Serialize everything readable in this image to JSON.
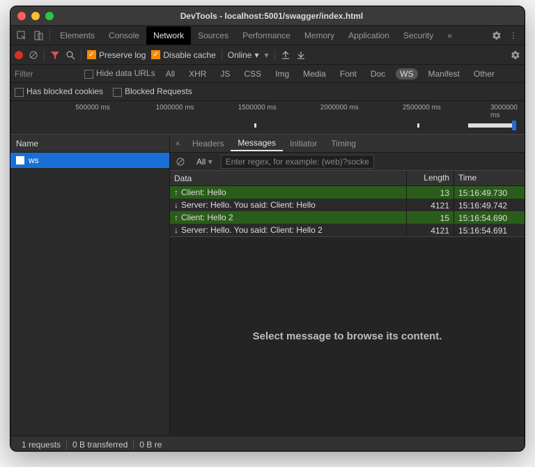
{
  "title": "DevTools - localhost:5001/swagger/index.html",
  "tabs": [
    "Elements",
    "Console",
    "Network",
    "Sources",
    "Performance",
    "Memory",
    "Application",
    "Security"
  ],
  "active_tab": "Network",
  "toolbar": {
    "preserve_log": "Preserve log",
    "disable_cache": "Disable cache",
    "throttle": "Online"
  },
  "filter": {
    "placeholder": "Filter",
    "hide_data_urls": "Hide data URLs",
    "types": [
      "All",
      "XHR",
      "JS",
      "CSS",
      "Img",
      "Media",
      "Font",
      "Doc",
      "WS",
      "Manifest",
      "Other"
    ]
  },
  "checkline": {
    "has_blocked_cookies": "Has blocked cookies",
    "blocked_requests": "Blocked Requests"
  },
  "timeline": {
    "ticks": [
      "500000 ms",
      "1000000 ms",
      "1500000 ms",
      "2000000 ms",
      "2500000 ms",
      "3000000 ms"
    ]
  },
  "names": {
    "header": "Name",
    "items": [
      "ws"
    ]
  },
  "subtabs": [
    "Headers",
    "Messages",
    "Initiator",
    "Timing"
  ],
  "active_subtab": "Messages",
  "msg_filter": {
    "all": "All",
    "placeholder": "Enter regex, for example: (web)?socket"
  },
  "table": {
    "headers": {
      "data": "Data",
      "length": "Length",
      "time": "Time"
    },
    "rows": [
      {
        "dir": "up",
        "data": "Client: Hello",
        "length": "13",
        "time": "15:16:49.730"
      },
      {
        "dir": "dn",
        "data": "Server: Hello. You said: Client: Hello",
        "length": "4121",
        "time": "15:16:49.742"
      },
      {
        "dir": "up",
        "data": "Client: Hello 2",
        "length": "15",
        "time": "15:16:54.690"
      },
      {
        "dir": "dn",
        "data": "Server: Hello. You said: Client: Hello 2",
        "length": "4121",
        "time": "15:16:54.691"
      }
    ]
  },
  "content_placeholder": "Select message to browse its content.",
  "status": {
    "requests": "1 requests",
    "transferred": "0 B transferred",
    "resources": "0 B re"
  }
}
